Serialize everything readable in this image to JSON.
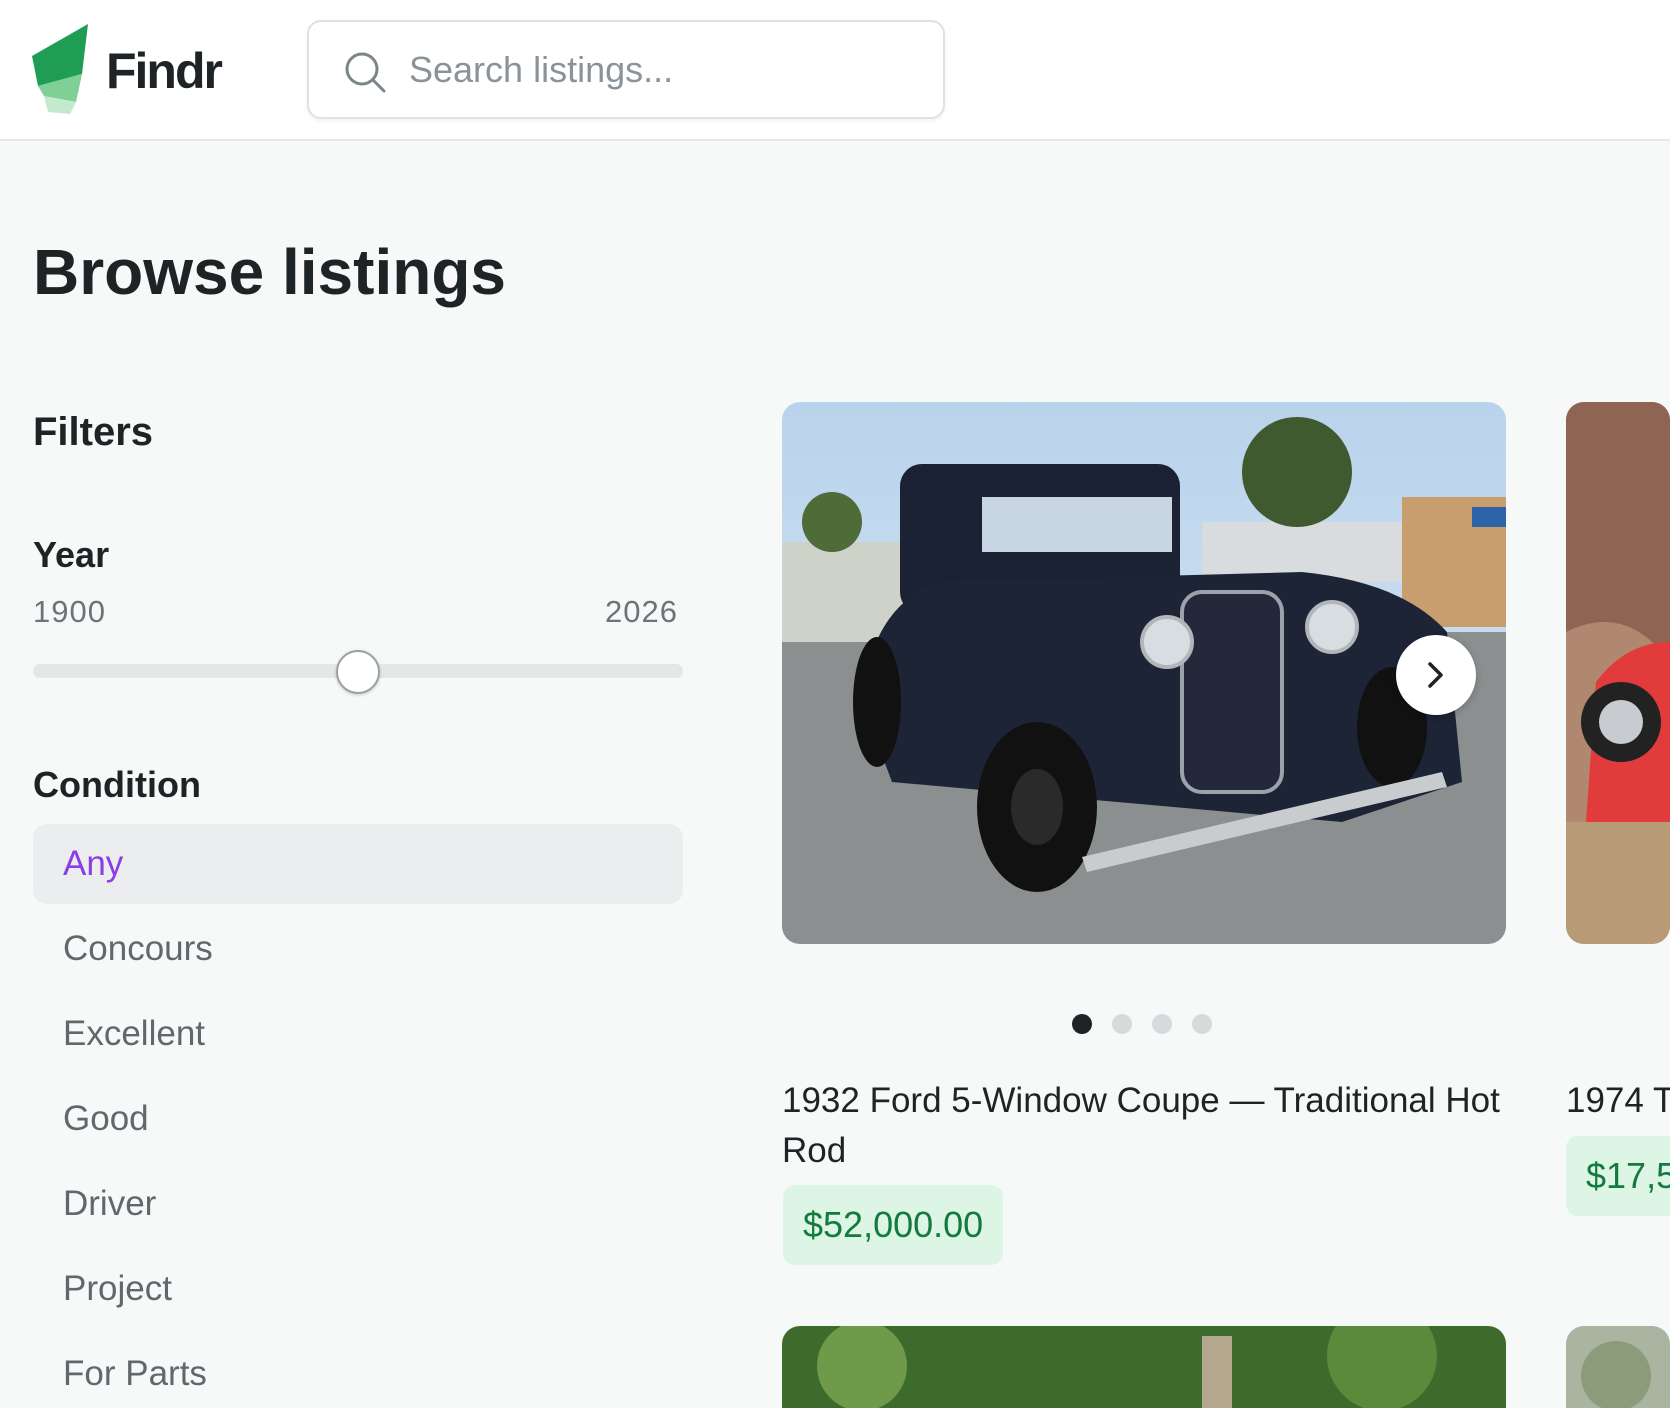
{
  "app": {
    "name": "Findr"
  },
  "search": {
    "placeholder": "Search listings..."
  },
  "page": {
    "title": "Browse listings"
  },
  "filters": {
    "title": "Filters",
    "year": {
      "label": "Year",
      "min": "1900",
      "max": "2026",
      "value_fraction": 0.5
    },
    "condition": {
      "label": "Condition",
      "options": [
        "Any",
        "Concours",
        "Excellent",
        "Good",
        "Driver",
        "Project",
        "For Parts"
      ],
      "selected": "Any"
    }
  },
  "listings": [
    {
      "title": "1932 Ford 5-Window Coupe — Traditional Hot Rod",
      "price": "$52,000.00",
      "image_count": 4,
      "current_image": 1
    },
    {
      "title": "1974 T",
      "price": "$17,5"
    }
  ],
  "colors": {
    "accent": "#8b3ee6",
    "brand": "#1f9d55",
    "price_bg": "#dcf5e4",
    "price_text": "#157a3d"
  }
}
